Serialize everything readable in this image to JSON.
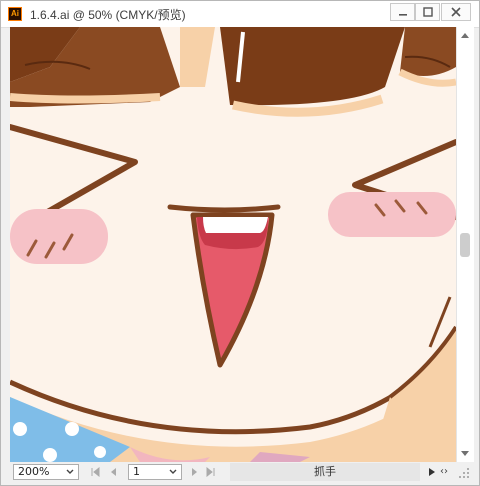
{
  "window": {
    "title": "1.6.4.ai @ 50% (CMYK/预览)",
    "app_icon_label": "Ai",
    "controls": [
      "minimize-icon",
      "maximize-icon",
      "close-icon"
    ]
  },
  "statusbar": {
    "zoom_value": "200%",
    "page_value": "1",
    "tool_label": "抓手"
  },
  "colors": {
    "skin": "#fdf3ea",
    "hair": "#7a3c17",
    "outline": "#7e4320",
    "blush": "#f6c2c7",
    "mouth_outer": "#c8394a",
    "mouth_inner": "#e65a6a",
    "teeth": "#ffffff",
    "shirt_blue": "#7fbde8",
    "skin_shadow": "#f7d1a8"
  }
}
